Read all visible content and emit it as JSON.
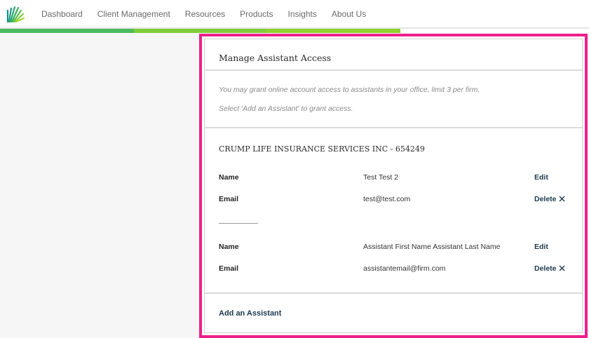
{
  "header": {
    "logo_icon": "fan-logo-icon",
    "nav": [
      {
        "label": "Dashboard"
      },
      {
        "label": "Client Management"
      },
      {
        "label": "Resources"
      },
      {
        "label": "Products"
      },
      {
        "label": "Insights"
      },
      {
        "label": "About Us"
      }
    ],
    "stripe_colors": [
      "#4dbb5f",
      "#7fcd3a",
      "#8ed12b"
    ]
  },
  "card": {
    "border_color": "#ee1f8c",
    "title": "Manage Assistant Access",
    "note1": "You may grant online account access to assistants in your office, limit 3 per firm.",
    "note2": "Select 'Add an Assistant' to grant access.",
    "firm": "CRUMP LIFE INSURANCE SERVICES INC - 654249",
    "assistants": [
      {
        "name_label": "Name",
        "name_value": "Test Test 2",
        "edit_label": "Edit",
        "email_label": "Email",
        "email_value": "test@test.com",
        "delete_label": "Delete"
      },
      {
        "name_label": "Name",
        "name_value": "Assistant First Name Assistant Last Name",
        "edit_label": "Edit",
        "email_label": "Email",
        "email_value": "assistantemail@firm.com",
        "delete_label": "Delete"
      }
    ],
    "add_label": "Add an Assistant"
  }
}
